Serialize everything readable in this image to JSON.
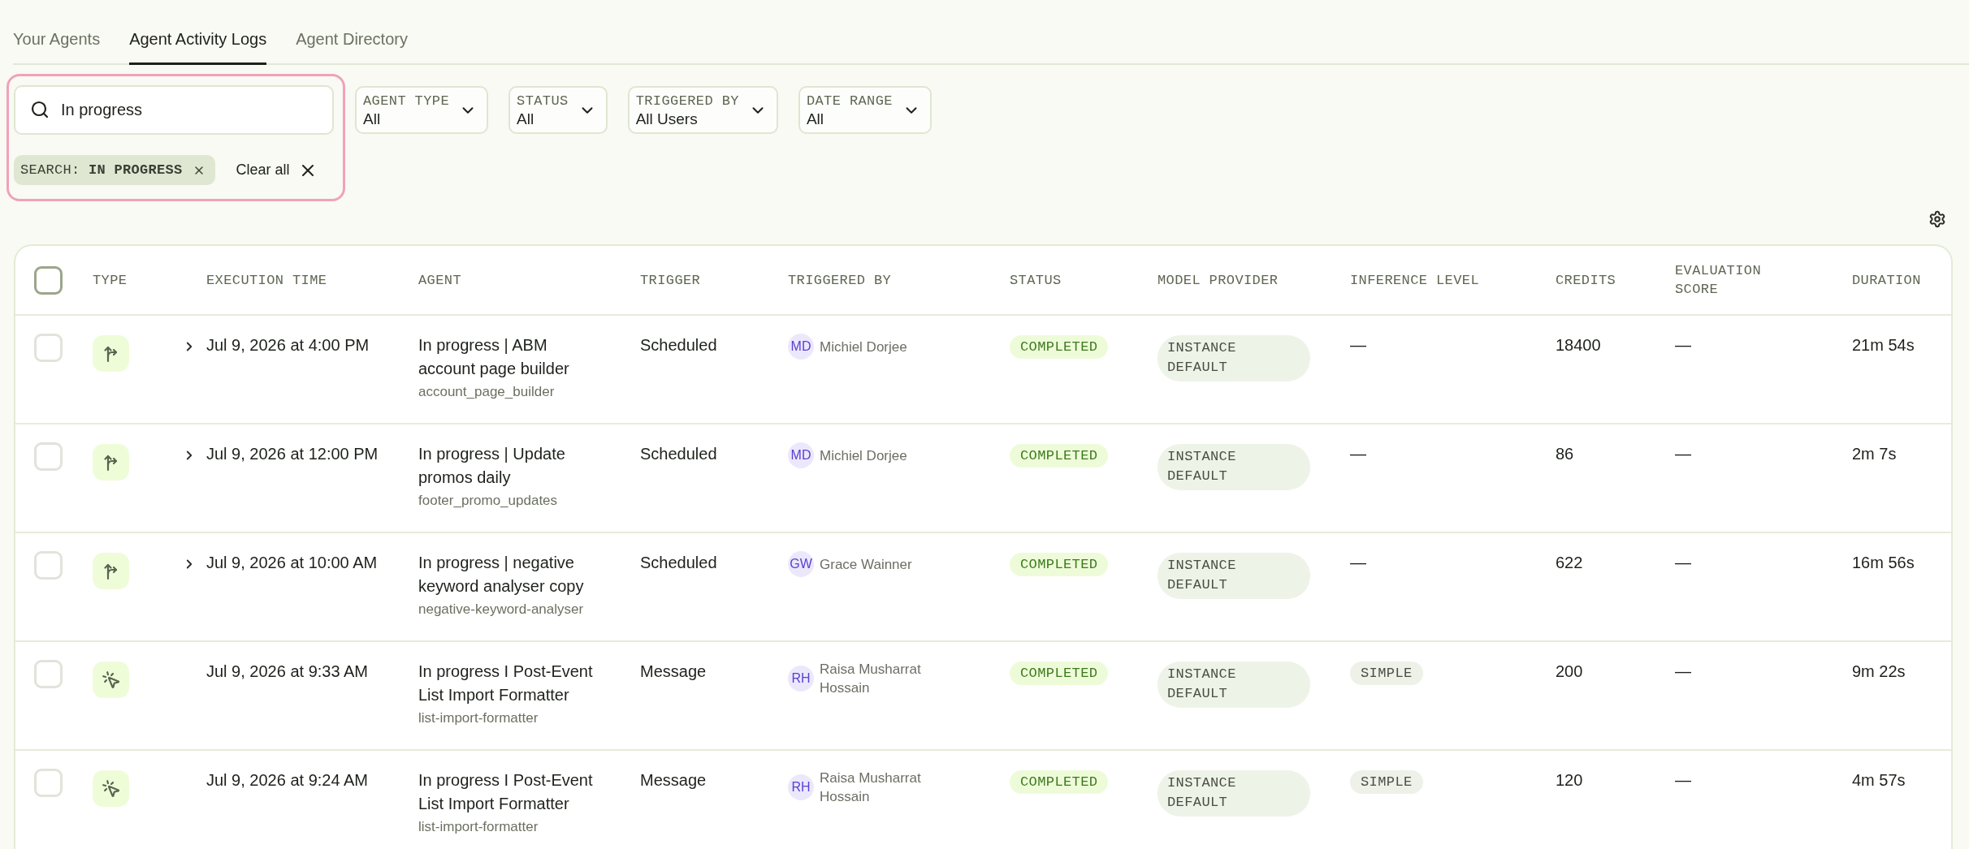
{
  "tabs": [
    {
      "label": "Your Agents",
      "selected": false
    },
    {
      "label": "Agent Activity Logs",
      "selected": true
    },
    {
      "label": "Agent Directory",
      "selected": false
    }
  ],
  "search": {
    "value": "In progress",
    "highlighted": true,
    "chip": "SEARCH: **IN PROGRESS**",
    "clear_label": "Clear all"
  },
  "filters": [
    {
      "label": "AGENT TYPE",
      "value": "All"
    },
    {
      "label": "STATUS",
      "value": "All"
    },
    {
      "label": "TRIGGERED BY",
      "value": "All Users"
    },
    {
      "label": "DATE RANGE",
      "value": "All"
    }
  ],
  "table": {
    "select_all": {
      "checked": false
    },
    "columns": [
      "TYPE",
      "EXECUTION TIME",
      "AGENT",
      "TRIGGER",
      "TRIGGERED BY",
      "STATUS",
      "MODEL PROVIDER",
      "INFERENCE LEVEL",
      "CREDITS",
      "EVALUATION SCORE",
      "DURATION"
    ],
    "rows": [
      {
        "checked": false,
        "kind": "scheduled",
        "expandable": true,
        "execution_time": "Jul 9, 2026 at 4:00 PM",
        "agent": {
          "name": "In progress | ABM account page builder",
          "id": "account_page_builder"
        },
        "trigger": "Scheduled",
        "triggered_by": {
          "initials": "MD",
          "name": "Michiel Dorjee"
        },
        "status": "COMPLETED",
        "model_provider": "INSTANCE DEFAULT",
        "inference_level": {
          "kind": "plain",
          "text": "—"
        },
        "credits": "18400",
        "evaluation_score": "—",
        "duration": "21m 54s"
      },
      {
        "checked": false,
        "kind": "scheduled",
        "expandable": true,
        "execution_time": "Jul 9, 2026 at 12:00 PM",
        "agent": {
          "name": "In progress | Update promos daily",
          "id": "footer_promo_updates"
        },
        "trigger": "Scheduled",
        "triggered_by": {
          "initials": "MD",
          "name": "Michiel Dorjee"
        },
        "status": "COMPLETED",
        "model_provider": "INSTANCE DEFAULT",
        "inference_level": {
          "kind": "plain",
          "text": "—"
        },
        "credits": "86",
        "evaluation_score": "—",
        "duration": "2m 7s"
      },
      {
        "checked": false,
        "kind": "scheduled",
        "expandable": true,
        "execution_time": "Jul 9, 2026 at 10:00 AM",
        "agent": {
          "name": "In progress | negative keyword analyser copy",
          "id": "negative-keyword-analyser"
        },
        "trigger": "Scheduled",
        "triggered_by": {
          "initials": "GW",
          "name": "Grace Wainner"
        },
        "status": "COMPLETED",
        "model_provider": "INSTANCE DEFAULT",
        "inference_level": {
          "kind": "plain",
          "text": "—"
        },
        "credits": "622",
        "evaluation_score": "—",
        "duration": "16m 56s"
      },
      {
        "checked": false,
        "kind": "message",
        "expandable": false,
        "execution_time": "Jul 9, 2026 at 9:33 AM",
        "agent": {
          "name": "In progress I Post-Event List Import Formatter",
          "id": "list-import-formatter"
        },
        "trigger": "Message",
        "triggered_by": {
          "initials": "RH",
          "name": "Raisa Musharrat Hossain"
        },
        "status": "COMPLETED",
        "model_provider": "INSTANCE DEFAULT",
        "inference_level": {
          "kind": "badge",
          "text": "SIMPLE"
        },
        "credits": "200",
        "evaluation_score": "—",
        "duration": "9m 22s"
      },
      {
        "checked": false,
        "kind": "message",
        "expandable": false,
        "execution_time": "Jul 9, 2026 at 9:24 AM",
        "agent": {
          "name": "In progress I Post-Event List Import Formatter",
          "id": "list-import-formatter"
        },
        "trigger": "Message",
        "triggered_by": {
          "initials": "RH",
          "name": "Raisa Musharrat Hossain"
        },
        "status": "COMPLETED",
        "model_provider": "INSTANCE DEFAULT",
        "inference_level": {
          "kind": "badge",
          "text": "SIMPLE"
        },
        "credits": "120",
        "evaluation_score": "—",
        "duration": "4m 57s"
      }
    ]
  }
}
